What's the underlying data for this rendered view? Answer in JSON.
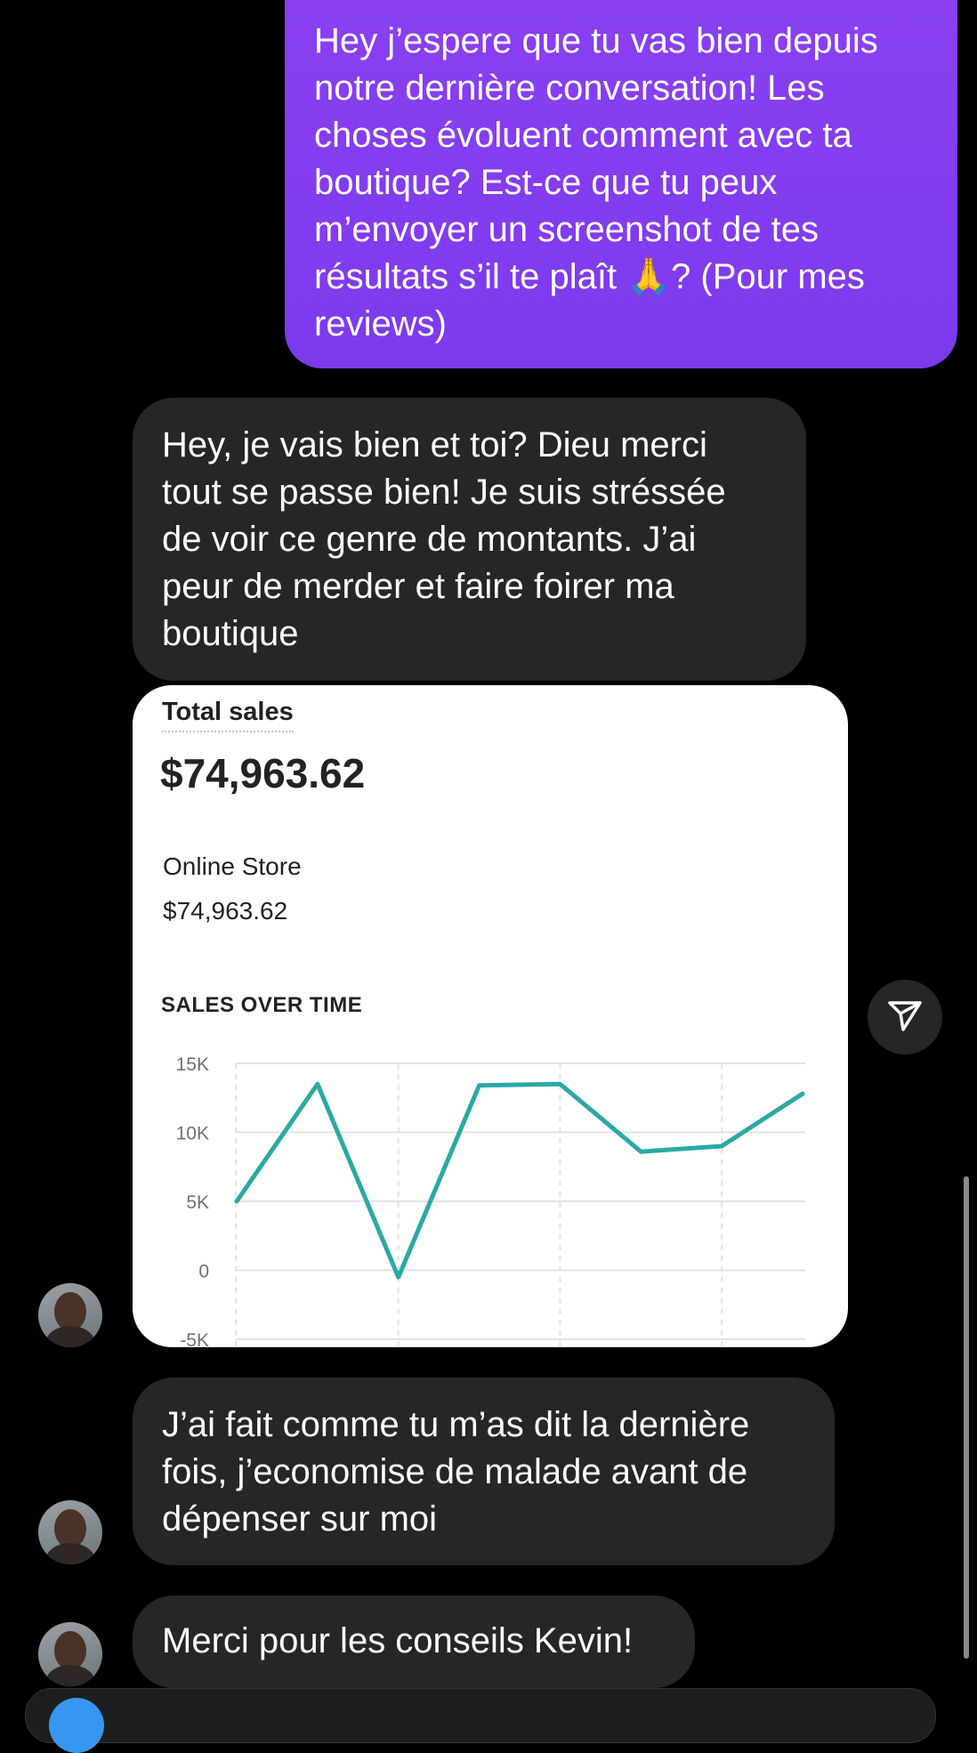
{
  "messages": {
    "sent_1": "Hey j’espere que tu vas bien depuis\nnotre dernière conversation! Les\nchoses évoluent comment avec ta\nboutique? Est-ce que tu peux\nm’envoyer un screenshot de tes\nrésultats s’il te plaît 🙏? (Pour mes\nreviews)",
    "received_1": "Hey, je vais bien et toi? Dieu merci\ntout se passe bien! Je suis stréssée\nde voir ce genre de montants. J’ai\npeur de merder et faire foirer ma\nboutique",
    "received_2": "J’ai fait comme tu m’as dit la dernière\nfois, j’economise de malade avant de\ndépenser sur moi",
    "received_3": "Merci pour les conseils Kevin!"
  },
  "card": {
    "title": "Total sales",
    "total": "$74,963.62",
    "store_label": "Online Store",
    "store_value": "$74,963.62",
    "section_title": "SALES OVER TIME"
  },
  "chart_data": {
    "type": "line",
    "y_tick_labels": [
      "15K",
      "10K",
      "5K",
      "0",
      "-5K"
    ],
    "y_ticks": [
      15000,
      10000,
      5000,
      0,
      -5000
    ],
    "ylim": [
      -5000,
      15000
    ],
    "series": [
      {
        "values": [
          5000,
          13500,
          -500,
          13400,
          13500,
          8600,
          9000,
          12800
        ]
      }
    ],
    "grid": true,
    "colors": {
      "line": "#2ba8a5",
      "grid": "#e1e3e5",
      "tick_text": "#6d7175"
    }
  },
  "colors": {
    "sent_bubble": "#7c3aed",
    "received_bubble": "#262626",
    "background": "#000000"
  }
}
